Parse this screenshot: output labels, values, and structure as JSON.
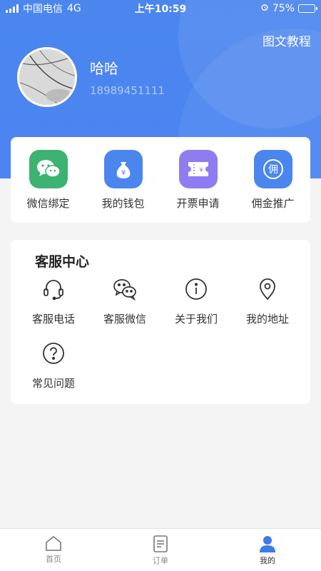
{
  "status_bar": {
    "carrier": "中国电信",
    "network": "4G",
    "time": "上午10:59",
    "battery": "75%",
    "battery_level": 0.75
  },
  "header": {
    "tutorial_link": "图文教程",
    "user_name": "哈哈",
    "user_phone": "18989451111"
  },
  "quick_actions": [
    {
      "label": "微信绑定",
      "icon": "wechat-icon",
      "color": "#3cb371"
    },
    {
      "label": "我的钱包",
      "icon": "money-bag-icon",
      "color": "#4a86ee"
    },
    {
      "label": "开票申请",
      "icon": "invoice-icon",
      "color": "#8f7cf0"
    },
    {
      "label": "佣金推广",
      "icon": "commission-icon",
      "color": "#4a86ee"
    }
  ],
  "service": {
    "title": "客服中心",
    "items": [
      {
        "label": "客服电话",
        "icon": "headset-icon"
      },
      {
        "label": "客服微信",
        "icon": "wechat-outline-icon"
      },
      {
        "label": "关于我们",
        "icon": "info-icon"
      },
      {
        "label": "我的地址",
        "icon": "location-pin-icon"
      },
      {
        "label": "常见问题",
        "icon": "question-icon"
      }
    ]
  },
  "tabbar": {
    "items": [
      {
        "label": "首页",
        "icon": "home-icon",
        "active": false
      },
      {
        "label": "订单",
        "icon": "order-icon",
        "active": false
      },
      {
        "label": "我的",
        "icon": "user-icon",
        "active": true
      }
    ]
  },
  "colors": {
    "primary": "#4a86ee",
    "wechat_green": "#3cb371",
    "invoice_purple": "#8f7cf0"
  },
  "commission_glyph": "佣",
  "yen_glyph": "¥"
}
